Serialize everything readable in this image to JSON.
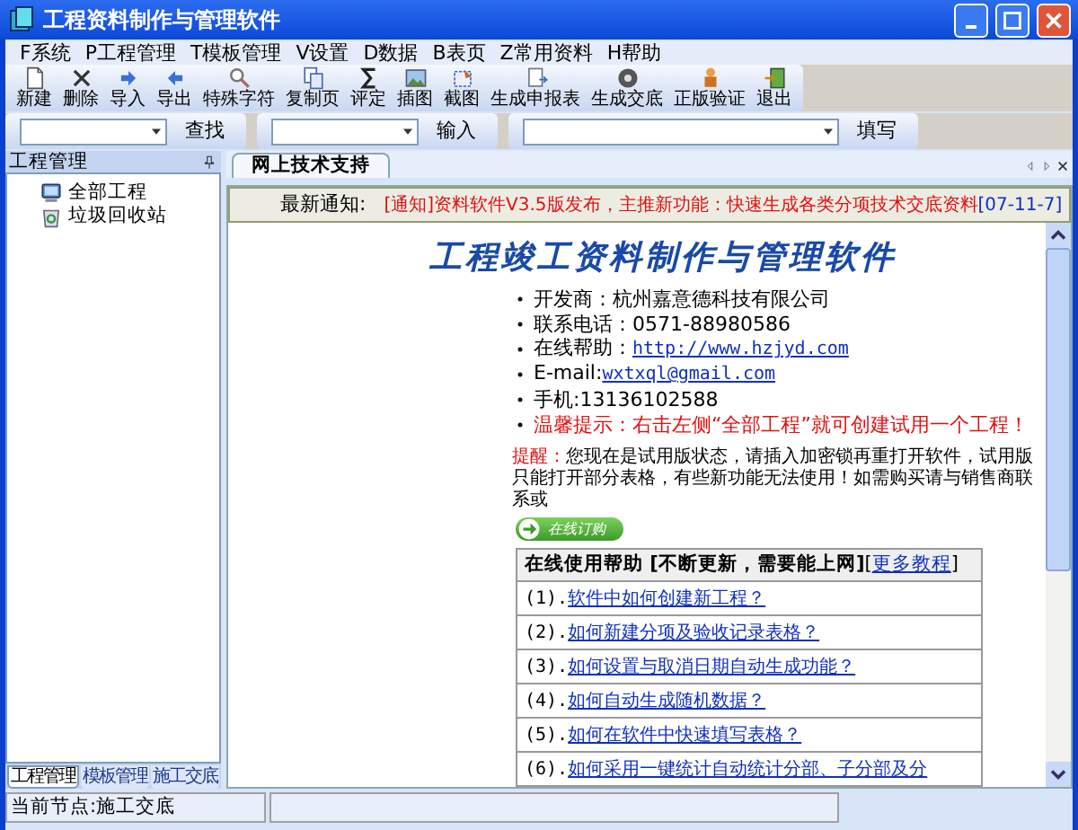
{
  "window": {
    "title": "工程资料制作与管理软件"
  },
  "menu": [
    "F系统",
    "P工程管理",
    "T模板管理",
    "V设置",
    "D数据",
    "B表页",
    "Z常用资料",
    "H帮助"
  ],
  "toolbar": [
    {
      "label": "新建",
      "kind": "page"
    },
    {
      "label": "删除",
      "kind": "cross"
    },
    {
      "label": "导入",
      "kind": "right"
    },
    {
      "label": "导出",
      "kind": "left"
    },
    {
      "label": "特殊字符",
      "kind": "magnifier"
    },
    {
      "label": "复制页",
      "kind": "copy"
    },
    {
      "label": "评定",
      "kind": "sigma"
    },
    {
      "label": "插图",
      "kind": "image"
    },
    {
      "label": "截图",
      "kind": "crop"
    },
    {
      "label": "生成申报表",
      "kind": "report"
    },
    {
      "label": "生成交底",
      "kind": "disc"
    },
    {
      "label": "正版验证",
      "kind": "figure"
    },
    {
      "label": "退出",
      "kind": "door"
    }
  ],
  "search_bar": [
    {
      "button": "查找"
    },
    {
      "button": "输入"
    },
    {
      "button": "填写"
    }
  ],
  "left_panel": {
    "title": "工程管理",
    "tree": [
      {
        "label": "全部工程",
        "kind": "computer"
      },
      {
        "label": "垃圾回收站",
        "kind": "recycle"
      }
    ],
    "tabs": [
      {
        "label": "工程管理",
        "selected": true
      },
      {
        "label": "模板管理",
        "selected": false
      },
      {
        "label": "施工交底",
        "selected": false
      }
    ]
  },
  "document_tabs": [
    {
      "label": "网上技术支持",
      "selected": true
    }
  ],
  "notice": {
    "label": "最新通知:",
    "text": "[通知]资料软件V3.5版发布，主推新功能：快速生成各类分项技术交底资料",
    "date": "[07-11-7]"
  },
  "page": {
    "heading": "工程竣工资料制作与管理软件",
    "contacts": [
      {
        "kind": "plain",
        "text": "开发商：杭州嘉意德科技有限公司"
      },
      {
        "kind": "plain",
        "text": "联系电话：0571-88980586"
      },
      {
        "kind": "link",
        "text": "在线帮助：",
        "link": "http://www.hzjyd.com"
      },
      {
        "kind": "link",
        "text": "E-mail:",
        "link": "wxtxql@gmail.com"
      },
      {
        "kind": "plain",
        "text": "手机:13136102588"
      },
      {
        "kind": "warning",
        "text": "温馨提示：右击左侧“全部工程”就可创建试用一个工程！"
      }
    ],
    "reminder": {
      "label": "提醒：",
      "text": "您现在是试用版状态，请插入加密锁再重打开软件，试用版只能打开部分表格，有些新功能无法使用！如需购买请与销售商联系或"
    },
    "order_button": "在线订购",
    "help": {
      "title": "在线使用帮助 [不断更新，需要能上网]",
      "more_open": "[",
      "more": "更多教程",
      "more_close": "]",
      "rows": [
        {
          "number": "(1).",
          "link": "软件中如何创建新工程？"
        },
        {
          "number": "(2).",
          "link": "如何新建分项及验收记录表格？"
        },
        {
          "number": "(3).",
          "link": "如何设置与取消日期自动生成功能？"
        },
        {
          "number": "(4).",
          "link": "如何自动生成随机数据？"
        },
        {
          "number": "(5).",
          "link": "如何在软件中快速填写表格？"
        },
        {
          "number": "(6).",
          "link": "如何采用一键统计自动统计分部、子分部及分"
        }
      ]
    }
  },
  "status_bar": "当前节点:施工交底"
}
